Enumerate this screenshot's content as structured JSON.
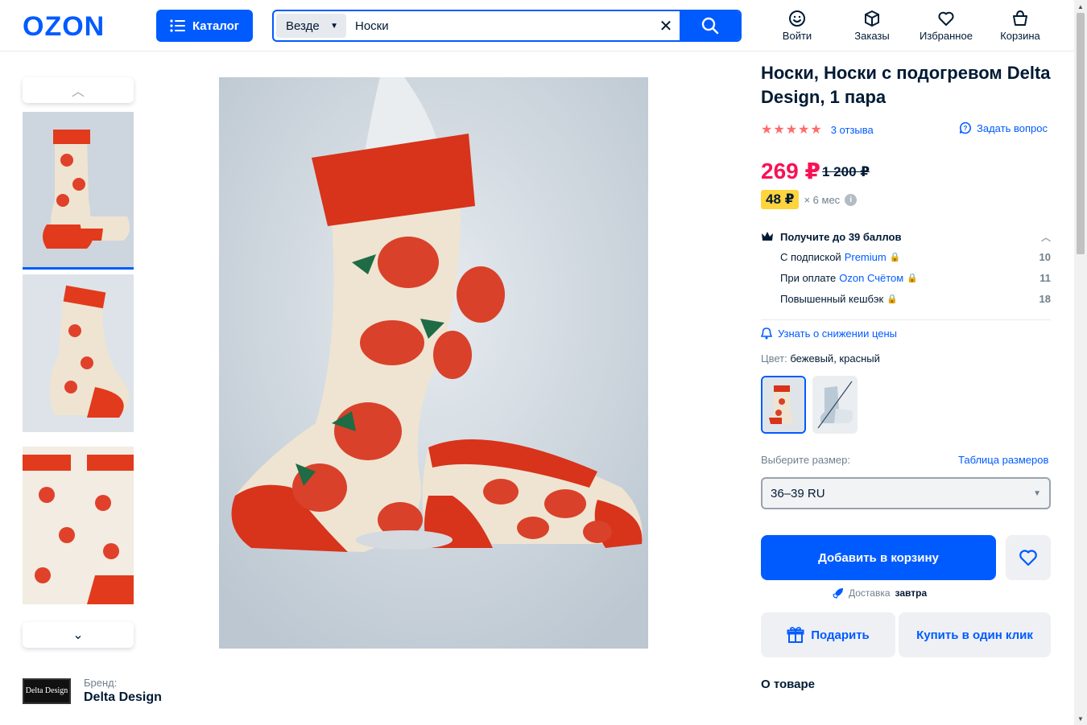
{
  "header": {
    "logo": "OZON",
    "catalog_label": "Каталог",
    "search_scope": "Везде",
    "search_value": "Носки",
    "nav": [
      {
        "label": "Войти",
        "icon": "smile-icon"
      },
      {
        "label": "Заказы",
        "icon": "box-icon"
      },
      {
        "label": "Избранное",
        "icon": "heart-icon"
      },
      {
        "label": "Корзина",
        "icon": "bag-icon"
      }
    ]
  },
  "gallery": {
    "thumbnails": [
      "socks-photo-1",
      "socks-photo-2",
      "socks-photo-3"
    ],
    "active_index": 0
  },
  "brand": {
    "label": "Бренд:",
    "name": "Delta Design",
    "logo_text": "Delta Design"
  },
  "product": {
    "title": "Носки, Носки с подогревом Delta Design, 1 пара",
    "rating": 5,
    "reviews": "3 отзыва",
    "ask_question": "Задать вопрос",
    "price": "269 ₽",
    "old_price": "1 200 ₽",
    "installment_amount": "48 ₽",
    "installment_term": "× 6 мес"
  },
  "points": {
    "header": "Получите до 39 баллов",
    "rows": [
      {
        "text": "С подпиской",
        "link": "Premium",
        "value": "10"
      },
      {
        "text": "При оплате",
        "link": "Ozon Счётом",
        "value": "11"
      },
      {
        "text": "Повышенный кешбэк",
        "link": "",
        "value": "18"
      }
    ]
  },
  "price_alert": "Узнать о снижении цены",
  "color": {
    "label": "Цвет:",
    "value": "бежевый, красный"
  },
  "size": {
    "label": "Выберите размер:",
    "table_link": "Таблица размеров",
    "selected": "36–39 RU"
  },
  "actions": {
    "add_to_cart": "Добавить в корзину",
    "delivery_prefix": "Доставка",
    "delivery_day": "завтра",
    "gift": "Подарить",
    "one_click": "Купить в один клик"
  },
  "about_title": "О товаре",
  "colors": {
    "brand_blue": "#005bff",
    "price_pink": "#f91155",
    "star": "#ff6b6b",
    "installment_yellow": "#ffd43d"
  }
}
